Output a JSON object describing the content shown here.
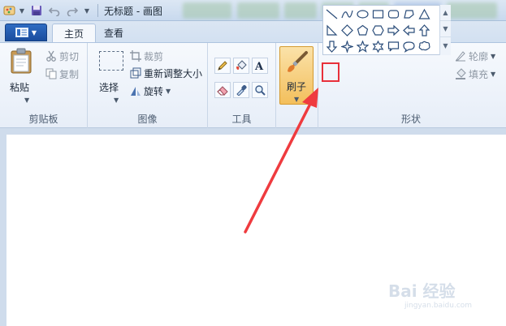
{
  "window": {
    "title": "无标题 - 画图"
  },
  "tabs": [
    {
      "label": "主页",
      "active": true
    },
    {
      "label": "查看",
      "active": false
    }
  ],
  "groups": {
    "clipboard": {
      "label": "剪贴板",
      "paste": "粘贴",
      "cut": "剪切",
      "copy": "复制"
    },
    "image": {
      "label": "图像",
      "select": "选择",
      "crop": "裁剪",
      "resize": "重新调整大小",
      "rotate": "旋转"
    },
    "tools": {
      "label": "工具"
    },
    "brushes": {
      "label": "刷子"
    },
    "shapes": {
      "label": "形状",
      "outline": "轮廓",
      "fill": "填充"
    }
  },
  "watermark": {
    "main": "Bai 经验",
    "sub": "jingyan.baidu.com"
  },
  "colors": {
    "annotation": "#e8303a",
    "file_button": "#1f58ad",
    "brush_highlight": "#f6c46b"
  }
}
